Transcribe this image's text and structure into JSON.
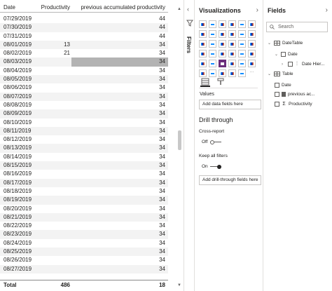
{
  "table": {
    "headers": [
      "Date",
      "Productivity",
      "previous accumulated productivity"
    ],
    "rows": [
      [
        "07/29/2019",
        "",
        "44"
      ],
      [
        "07/30/2019",
        "",
        "44"
      ],
      [
        "07/31/2019",
        "",
        "44"
      ],
      [
        "08/01/2019",
        "13",
        "34"
      ],
      [
        "08/02/2019",
        "21",
        "34"
      ],
      [
        "08/03/2019",
        "",
        "34"
      ],
      [
        "08/04/2019",
        "",
        "34"
      ],
      [
        "08/05/2019",
        "",
        "34"
      ],
      [
        "08/06/2019",
        "",
        "34"
      ],
      [
        "08/07/2019",
        "",
        "34"
      ],
      [
        "08/08/2019",
        "",
        "34"
      ],
      [
        "08/09/2019",
        "",
        "34"
      ],
      [
        "08/10/2019",
        "",
        "34"
      ],
      [
        "08/11/2019",
        "",
        "34"
      ],
      [
        "08/12/2019",
        "",
        "34"
      ],
      [
        "08/13/2019",
        "",
        "34"
      ],
      [
        "08/14/2019",
        "",
        "34"
      ],
      [
        "08/15/2019",
        "",
        "34"
      ],
      [
        "08/16/2019",
        "",
        "34"
      ],
      [
        "08/17/2019",
        "",
        "34"
      ],
      [
        "08/18/2019",
        "",
        "34"
      ],
      [
        "08/19/2019",
        "",
        "34"
      ],
      [
        "08/20/2019",
        "",
        "34"
      ],
      [
        "08/21/2019",
        "",
        "34"
      ],
      [
        "08/22/2019",
        "",
        "34"
      ],
      [
        "08/23/2019",
        "",
        "34"
      ],
      [
        "08/24/2019",
        "",
        "34"
      ],
      [
        "08/25/2019",
        "",
        "34"
      ],
      [
        "08/26/2019",
        "",
        "34"
      ],
      [
        "08/27/2019",
        "",
        "34"
      ]
    ],
    "selected_row": 5,
    "total": {
      "label": "Total",
      "productivity": "486",
      "previous": "18"
    }
  },
  "filters": {
    "label": "Filters",
    "chevron": "‹",
    "icon": "funnel-icon"
  },
  "visualizations": {
    "title": "Visualizations",
    "chevron": "›",
    "build_tab_icon": "build-visual-icon",
    "format_tab_icon": "format-paintbrush-icon",
    "values_label": "Values",
    "values_placeholder": "Add data fields here",
    "drill_through": {
      "title": "Drill through",
      "cross_report_label": "Cross-report",
      "cross_report_state": "Off",
      "keep_filters_label": "Keep all filters",
      "keep_filters_state": "On",
      "placeholder": "Add drill-through fields here"
    },
    "accent_color": "#6b2d7b"
  },
  "fields": {
    "title": "Fields",
    "chevron": "›",
    "search_placeholder": "Search",
    "tree": [
      {
        "level": 0,
        "type": "table",
        "label": "DateTable",
        "expanded": true
      },
      {
        "level": 1,
        "type": "field",
        "label": "Date",
        "expanded": true
      },
      {
        "level": 2,
        "type": "hierarchy",
        "label": "Date Hier...",
        "expanded": false
      },
      {
        "level": 0,
        "type": "table",
        "label": "Table",
        "expanded": true
      },
      {
        "level": 1,
        "type": "field",
        "label": "Date"
      },
      {
        "level": 1,
        "type": "measure",
        "label": "previous ac..."
      },
      {
        "level": 1,
        "type": "sum",
        "label": "Productivity"
      }
    ]
  }
}
